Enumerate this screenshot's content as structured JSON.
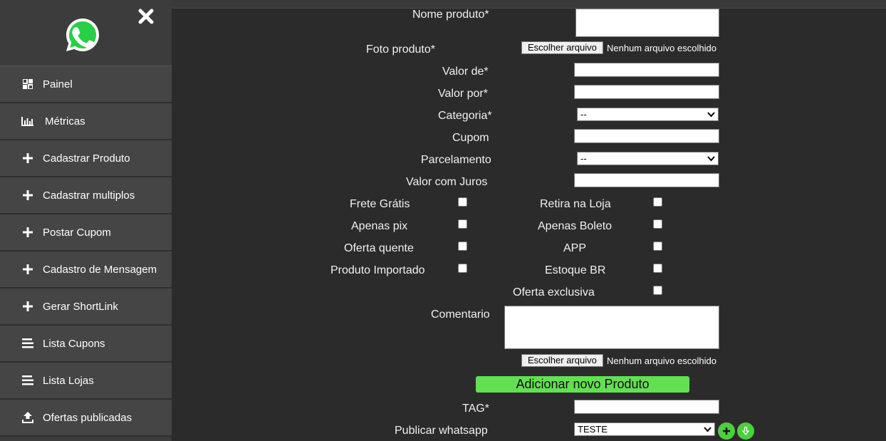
{
  "sidebar": {
    "items": [
      {
        "label": "Painel",
        "icon": "grid-icon"
      },
      {
        "label": "Métricas",
        "icon": "bar-chart-icon"
      },
      {
        "label": "Cadastrar Produto",
        "icon": "plus-icon"
      },
      {
        "label": "Cadastrar multiplos",
        "icon": "plus-icon"
      },
      {
        "label": "Postar Cupom",
        "icon": "plus-icon"
      },
      {
        "label": "Cadastro de Mensagem",
        "icon": "plus-icon"
      },
      {
        "label": "Gerar ShortLink",
        "icon": "plus-icon"
      },
      {
        "label": "Lista Cupons",
        "icon": "list-icon"
      },
      {
        "label": "Lista Lojas",
        "icon": "list-icon"
      },
      {
        "label": "Ofertas publicadas",
        "icon": "upload-icon"
      }
    ]
  },
  "form": {
    "nome_produto_label": "Nome produto*",
    "foto_produto_label": "Foto produto*",
    "file_button": "Escolher arquivo",
    "file_none": "Nenhum arquivo escolhido",
    "valor_de_label": "Valor de*",
    "valor_por_label": "Valor por*",
    "categoria_label": "Categoria*",
    "categoria_value": "--",
    "cupom_label": "Cupom",
    "parcelamento_label": "Parcelamento",
    "parcelamento_value": "--",
    "valor_juros_label": "Valor com Juros",
    "checks": {
      "frete_gratis": "Frete Grátis",
      "retira_loja": "Retira na Loja",
      "apenas_pix": "Apenas pix",
      "apenas_boleto": "Apenas Boleto",
      "oferta_quente": "Oferta quente",
      "app": "APP",
      "produto_importado": "Produto Importado",
      "estoque_br": "Estoque BR",
      "oferta_exclusiva": "Oferta exclusiva"
    },
    "comentario_label": "Comentario",
    "add_button": "Adicionar novo Produto",
    "tag_label": "TAG*",
    "publicar_label": "Publicar whatsapp",
    "publicar_value": "TESTE"
  },
  "colors": {
    "accent_green": "#62e052",
    "background": "#2b2b2b",
    "sidebar": "#454545"
  }
}
